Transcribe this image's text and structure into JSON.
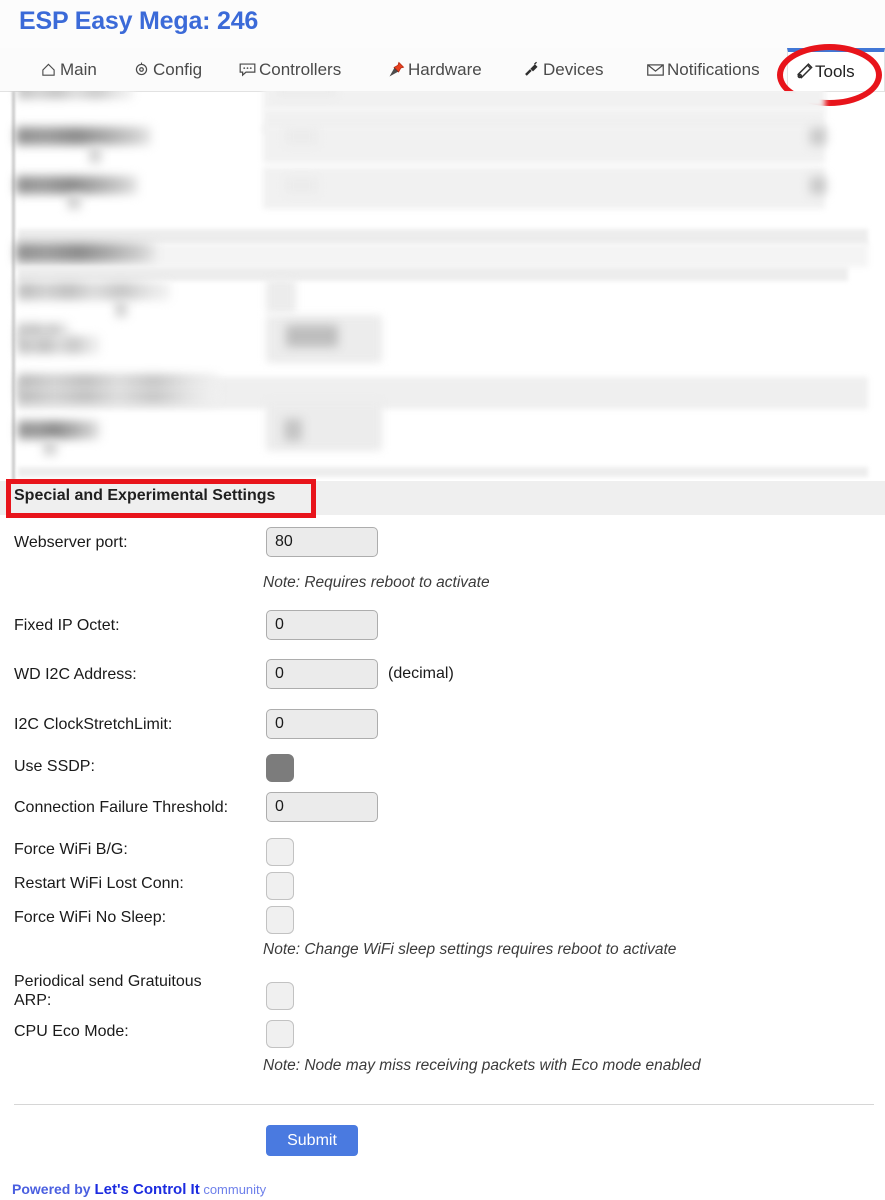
{
  "header": {
    "app_title": "ESP Easy Mega: 246",
    "title_color": "#3b6ad8"
  },
  "nav": {
    "active_tab": "Tools",
    "active_border_color": "#4177d6",
    "annotation_color": "#e8141b",
    "tabs": [
      {
        "label": "Main",
        "icon": "home-icon",
        "name": "tab-main"
      },
      {
        "label": "Config",
        "icon": "gear-icon",
        "name": "tab-config"
      },
      {
        "label": "Controllers",
        "icon": "chat-bubble-icon",
        "name": "tab-controllers"
      },
      {
        "label": "Hardware",
        "icon": "pushpin-icon",
        "name": "tab-hardware"
      },
      {
        "label": "Devices",
        "icon": "plug-icon",
        "name": "tab-devices"
      },
      {
        "label": "Notifications",
        "icon": "envelope-icon",
        "name": "tab-notifications"
      },
      {
        "label": "Tools",
        "icon": "wrench-icon",
        "name": "tab-tools"
      }
    ]
  },
  "redacted_region": {
    "note": "upper settings area is blurred/redacted in the screenshot; no text is legible"
  },
  "section": {
    "title": "Special and Experimental Settings",
    "highlight_color": "#e8141b"
  },
  "fields": {
    "webserver_port": {
      "label": "Webserver port:",
      "value": "80",
      "note": "Note: Requires reboot to activate"
    },
    "fixed_ip_octet": {
      "label": "Fixed IP Octet:",
      "value": "0"
    },
    "wd_i2c_address": {
      "label": "WD I2C Address:",
      "value": "0",
      "suffix": "(decimal)"
    },
    "i2c_clockstretchlimit": {
      "label": "I2C ClockStretchLimit:",
      "value": "0"
    },
    "use_ssdp": {
      "label": "Use SSDP:",
      "checked": true
    },
    "connection_failure_threshold": {
      "label": "Connection Failure Threshold:",
      "value": "0"
    },
    "force_wifi_bg": {
      "label": "Force WiFi B/G:",
      "checked": false
    },
    "restart_wifi_lost_conn": {
      "label": "Restart WiFi Lost Conn:",
      "checked": false
    },
    "force_wifi_no_sleep": {
      "label": "Force WiFi No Sleep:",
      "checked": false,
      "note": "Note: Change WiFi sleep settings requires reboot to activate"
    },
    "periodical_gratuitous_arp": {
      "label": "Periodical send Gratuitous\nARP:",
      "checked": false
    },
    "cpu_eco_mode": {
      "label": "CPU Eco Mode:",
      "checked": false,
      "note": "Note: Node may miss receiving packets with Eco mode enabled"
    }
  },
  "actions": {
    "submit_label": "Submit",
    "submit_color": "#4a7ae0"
  },
  "footer": {
    "prefix": "Powered by ",
    "brand": "Let's Control It",
    "suffix": " community"
  }
}
